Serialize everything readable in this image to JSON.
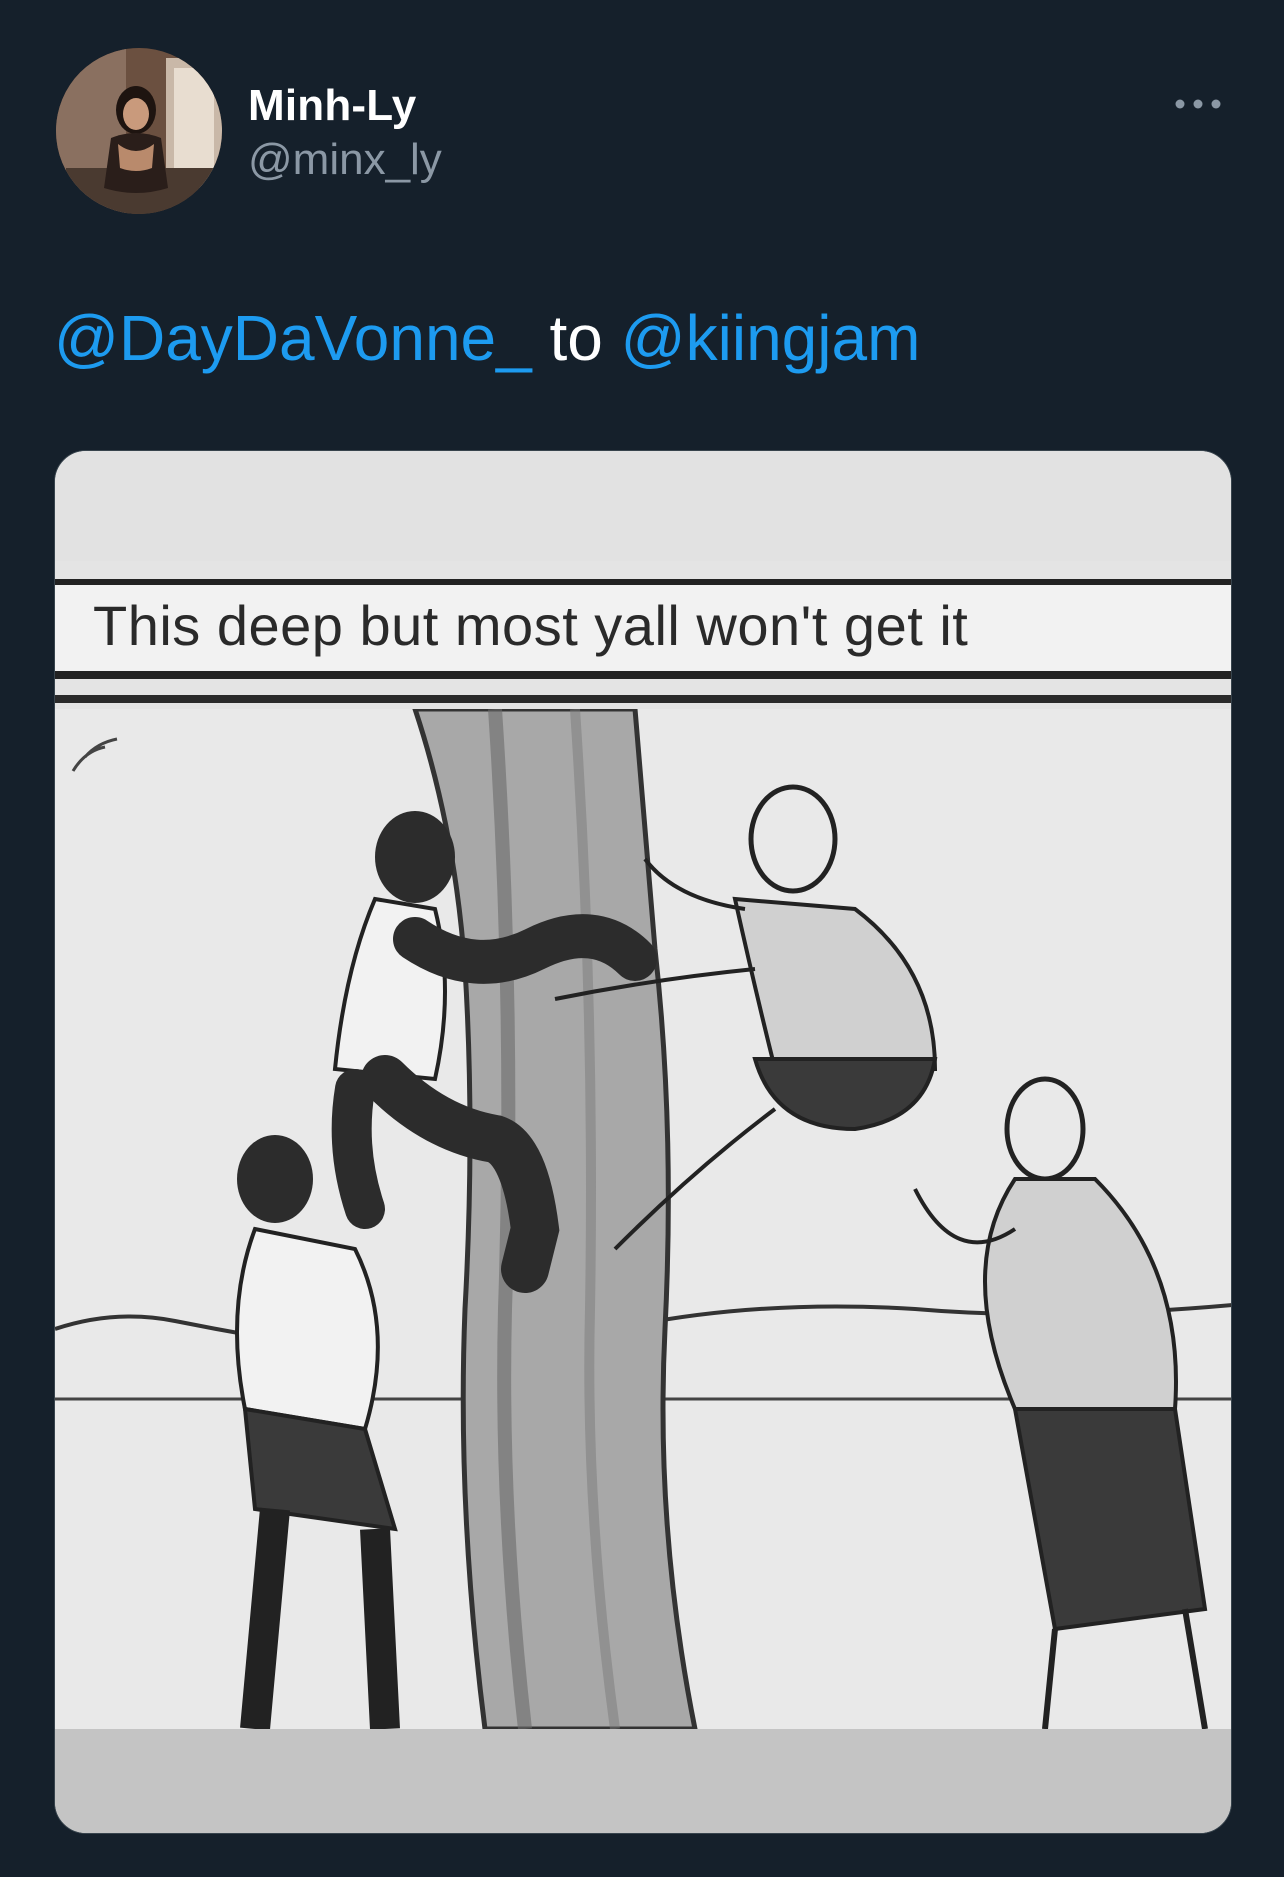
{
  "user": {
    "display_name": "Minh-Ly",
    "handle": "@minx_ly"
  },
  "more_icon": "more-horizontal-icon",
  "tweet": {
    "mention_1": "@DayDaVonne_",
    "joiner": "to",
    "mention_2": "@kiingjam"
  },
  "media": {
    "caption": "This deep but most yall won't get it"
  },
  "colors": {
    "background": "#15202b",
    "link": "#1d9bf0",
    "secondary_text": "#8b98a5"
  }
}
